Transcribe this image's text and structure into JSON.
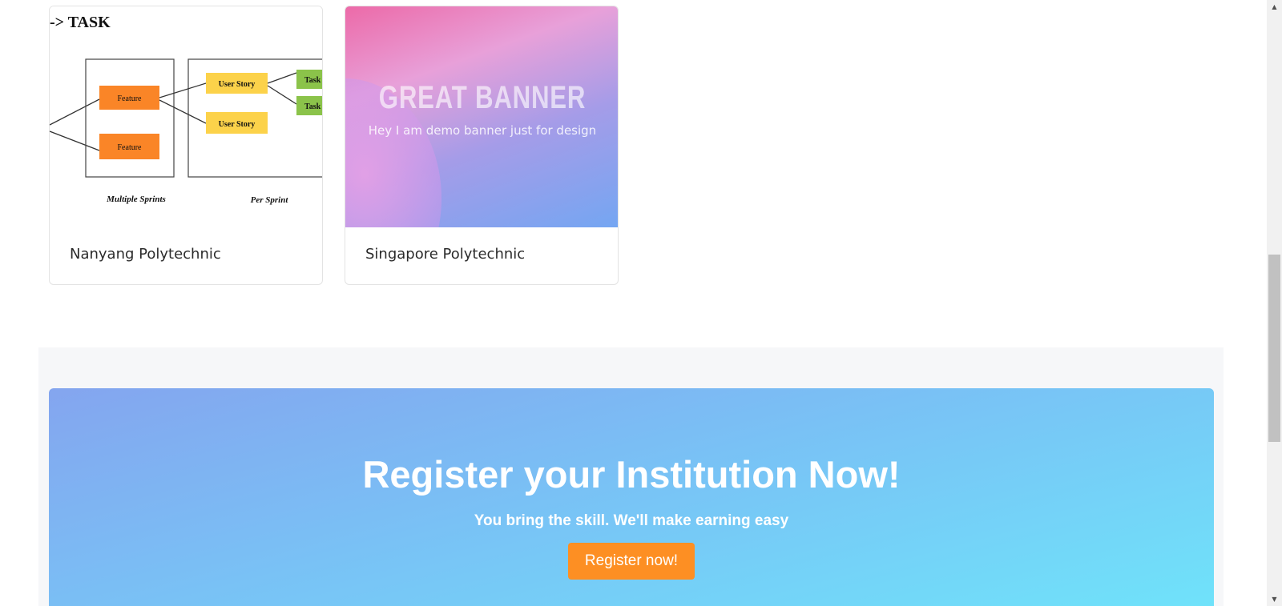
{
  "cards": [
    {
      "title": "Nanyang Polytechnic",
      "diagram": {
        "heading": "-> TASK",
        "feature_label": "Feature",
        "user_story_label": "User Story",
        "task_label": "Task",
        "multiple_sprints_label": "Multiple Sprints",
        "per_sprint_label": "Per Sprint"
      }
    },
    {
      "title": "Singapore Polytechnic",
      "banner": {
        "title": "GREAT BANNER",
        "subtitle": "Hey I am demo banner just for design"
      }
    }
  ],
  "cta": {
    "title": "Register your Institution Now!",
    "subtitle": "You bring the skill. We'll make earning easy",
    "button_label": "Register now!",
    "button_color": "#fd8f23"
  },
  "scrollbar": {
    "up_icon": "▲",
    "down_icon": "▼"
  }
}
